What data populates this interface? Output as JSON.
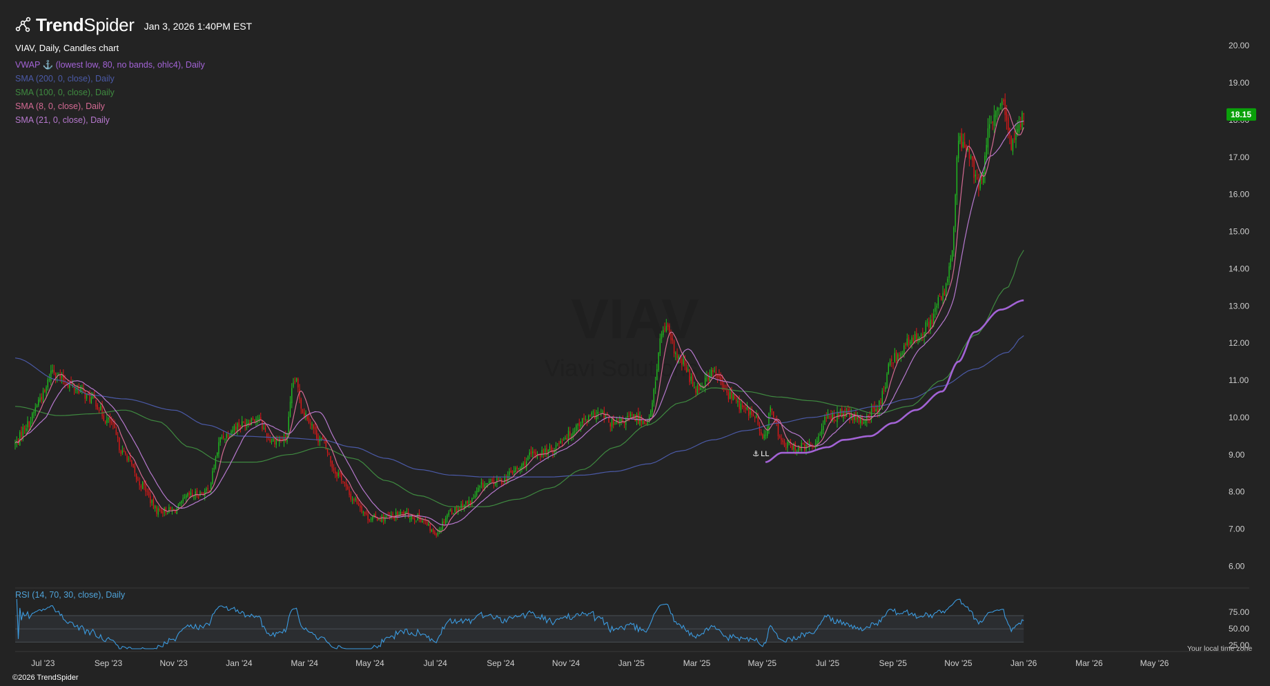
{
  "header": {
    "brand_bold": "Trend",
    "brand_light": "Spider",
    "timestamp": "Jan 3, 2026 1:40PM EST"
  },
  "legend": {
    "title": "VIAV, Daily, Candles chart",
    "items": [
      {
        "label": "VWAP ⚓ (lowest low, 80, no bands, ohlc4), Daily",
        "color": "#a363d6"
      },
      {
        "label": "SMA (200, 0, close), Daily",
        "color": "#4b5aa8"
      },
      {
        "label": "SMA (100, 0, close), Daily",
        "color": "#3f8a40"
      },
      {
        "label": "SMA (8, 0, close), Daily",
        "color": "#d46a94"
      },
      {
        "label": "SMA (21, 0, close), Daily",
        "color": "#b779cf"
      }
    ]
  },
  "watermark": {
    "symbol": "VIAV",
    "name": "Viavi Solutions"
  },
  "anchor_label": "LL",
  "rsi_label": "RSI (14, 70, 30, close), Daily",
  "footer": "©2026 TrendSpider",
  "timezone_note": "Your local time zone",
  "colors": {
    "up": "#20c020",
    "down": "#e01818",
    "background": "#232323",
    "rsi": "#3b9be0",
    "price_tag": "#0aa00a"
  },
  "chart_data": {
    "type": "candlestick",
    "ticker": "VIAV",
    "last_price": "18.15",
    "y_ticks": [
      "6.00",
      "7.00",
      "8.00",
      "9.00",
      "10.00",
      "11.00",
      "12.00",
      "13.00",
      "14.00",
      "15.00",
      "16.00",
      "17.00",
      "18.00",
      "19.00",
      "20.00"
    ],
    "ylim": [
      5.6,
      20.3
    ],
    "x_ticks": [
      "Jul '23",
      "Sep '23",
      "Nov '23",
      "Jan '24",
      "Mar '24",
      "May '24",
      "Jul '24",
      "Sep '24",
      "Nov '24",
      "Jan '25",
      "Mar '25",
      "May '25",
      "Jul '25",
      "Sep '25",
      "Nov '25",
      "Jan '26",
      "Mar '26",
      "May '26"
    ],
    "x_tick_months": [
      0,
      2,
      4,
      6,
      8,
      10,
      12,
      14,
      16,
      18,
      20,
      22,
      24,
      26,
      28,
      30,
      32,
      34
    ],
    "xlim_months": [
      -0.85,
      35.0
    ],
    "price_anchors": [
      [
        -0.85,
        9.3
      ],
      [
        -0.5,
        9.8
      ],
      [
        0,
        10.6
      ],
      [
        0.3,
        11.3
      ],
      [
        0.6,
        11.0
      ],
      [
        1.0,
        10.8
      ],
      [
        1.5,
        10.5
      ],
      [
        2.0,
        9.9
      ],
      [
        2.5,
        9.0
      ],
      [
        3.0,
        8.2
      ],
      [
        3.5,
        7.5
      ],
      [
        4.0,
        7.5
      ],
      [
        4.5,
        7.9
      ],
      [
        5.0,
        8.0
      ],
      [
        5.5,
        9.5
      ],
      [
        6.0,
        9.8
      ],
      [
        6.5,
        10.0
      ],
      [
        7.0,
        9.4
      ],
      [
        7.4,
        9.4
      ],
      [
        7.7,
        11.0
      ],
      [
        8.0,
        10.1
      ],
      [
        8.5,
        9.4
      ],
      [
        9.0,
        8.5
      ],
      [
        9.5,
        7.8
      ],
      [
        10.0,
        7.3
      ],
      [
        10.5,
        7.3
      ],
      [
        11.0,
        7.4
      ],
      [
        11.5,
        7.3
      ],
      [
        12.0,
        6.9
      ],
      [
        12.5,
        7.5
      ],
      [
        13.0,
        7.7
      ],
      [
        13.5,
        8.2
      ],
      [
        14.0,
        8.3
      ],
      [
        14.5,
        8.6
      ],
      [
        15.0,
        9.0
      ],
      [
        15.5,
        9.1
      ],
      [
        16.0,
        9.5
      ],
      [
        16.5,
        9.9
      ],
      [
        17.0,
        10.1
      ],
      [
        17.5,
        9.8
      ],
      [
        18.0,
        10.0
      ],
      [
        18.5,
        9.9
      ],
      [
        19.0,
        12.4
      ],
      [
        19.5,
        11.5
      ],
      [
        20.0,
        10.8
      ],
      [
        20.5,
        11.2
      ],
      [
        21.0,
        10.6
      ],
      [
        21.5,
        10.2
      ],
      [
        21.8,
        10.0
      ],
      [
        22.0,
        9.4
      ],
      [
        22.3,
        10.2
      ],
      [
        22.6,
        9.3
      ],
      [
        23.0,
        9.2
      ],
      [
        23.5,
        9.2
      ],
      [
        24.0,
        10.0
      ],
      [
        24.5,
        10.1
      ],
      [
        25.0,
        9.9
      ],
      [
        25.5,
        10.2
      ],
      [
        25.6,
        10.5
      ],
      [
        26.0,
        11.6
      ],
      [
        26.5,
        12.0
      ],
      [
        27.0,
        12.4
      ],
      [
        27.5,
        13.2
      ],
      [
        27.8,
        14.3
      ],
      [
        28.0,
        17.4
      ],
      [
        28.3,
        17.2
      ],
      [
        28.6,
        16.2
      ],
      [
        29.0,
        17.8
      ],
      [
        29.3,
        18.5
      ],
      [
        29.6,
        17.4
      ],
      [
        30.0,
        18.15
      ]
    ],
    "sma_200_anchors": [
      [
        -0.85,
        11.6
      ],
      [
        0.5,
        11.0
      ],
      [
        1.5,
        10.6
      ],
      [
        2.5,
        10.5
      ],
      [
        4.0,
        10.2
      ],
      [
        5.0,
        9.8
      ],
      [
        6.0,
        9.5
      ],
      [
        7.5,
        9.45
      ],
      [
        8.5,
        9.4
      ],
      [
        9.5,
        9.2
      ],
      [
        10.5,
        8.9
      ],
      [
        11.5,
        8.6
      ],
      [
        12.5,
        8.45
      ],
      [
        13.5,
        8.4
      ],
      [
        14.5,
        8.4
      ],
      [
        15.5,
        8.4
      ],
      [
        16.5,
        8.45
      ],
      [
        17.5,
        8.55
      ],
      [
        18.5,
        8.75
      ],
      [
        19.5,
        9.1
      ],
      [
        20.5,
        9.4
      ],
      [
        21.5,
        9.65
      ],
      [
        22.5,
        9.85
      ],
      [
        23.5,
        10.0
      ],
      [
        24.5,
        10.15
      ],
      [
        25.5,
        10.3
      ],
      [
        26.5,
        10.5
      ],
      [
        27.5,
        10.85
      ],
      [
        28.5,
        11.3
      ],
      [
        29.5,
        11.75
      ],
      [
        30.0,
        12.2
      ]
    ],
    "sma_100_anchors": [
      [
        -0.85,
        10.3
      ],
      [
        0.5,
        10.05
      ],
      [
        1.5,
        10.1
      ],
      [
        2.5,
        10.2
      ],
      [
        3.5,
        9.9
      ],
      [
        4.5,
        9.2
      ],
      [
        5.5,
        8.8
      ],
      [
        6.5,
        8.8
      ],
      [
        7.5,
        9.0
      ],
      [
        8.5,
        9.2
      ],
      [
        9.5,
        8.9
      ],
      [
        10.5,
        8.3
      ],
      [
        11.5,
        7.9
      ],
      [
        12.5,
        7.6
      ],
      [
        13.5,
        7.6
      ],
      [
        14.5,
        7.8
      ],
      [
        15.5,
        8.1
      ],
      [
        16.5,
        8.6
      ],
      [
        17.5,
        9.2
      ],
      [
        18.5,
        9.8
      ],
      [
        19.5,
        10.4
      ],
      [
        20.5,
        10.8
      ],
      [
        21.5,
        10.7
      ],
      [
        22.5,
        10.55
      ],
      [
        23.5,
        10.45
      ],
      [
        24.5,
        10.3
      ],
      [
        25.5,
        10.1
      ],
      [
        26.5,
        10.3
      ],
      [
        27.5,
        11.0
      ],
      [
        28.5,
        12.2
      ],
      [
        29.5,
        13.5
      ],
      [
        30.0,
        14.5
      ]
    ],
    "vwap_anchors": [
      [
        22.1,
        8.8
      ],
      [
        22.6,
        9.05
      ],
      [
        23.3,
        9.05
      ],
      [
        24.0,
        9.2
      ],
      [
        24.5,
        9.4
      ],
      [
        25.3,
        9.5
      ],
      [
        26.0,
        9.85
      ],
      [
        26.7,
        10.2
      ],
      [
        27.5,
        10.7
      ],
      [
        28.0,
        11.5
      ],
      [
        28.5,
        12.3
      ],
      [
        29.3,
        12.9
      ],
      [
        30.0,
        13.15
      ]
    ],
    "anchor_month": 22.0,
    "rsi_ticks": [
      "25.00",
      "50.00",
      "75.00"
    ],
    "rsi_ylim": [
      20,
      95
    ],
    "rsi_bands": [
      30,
      50,
      70
    ]
  }
}
